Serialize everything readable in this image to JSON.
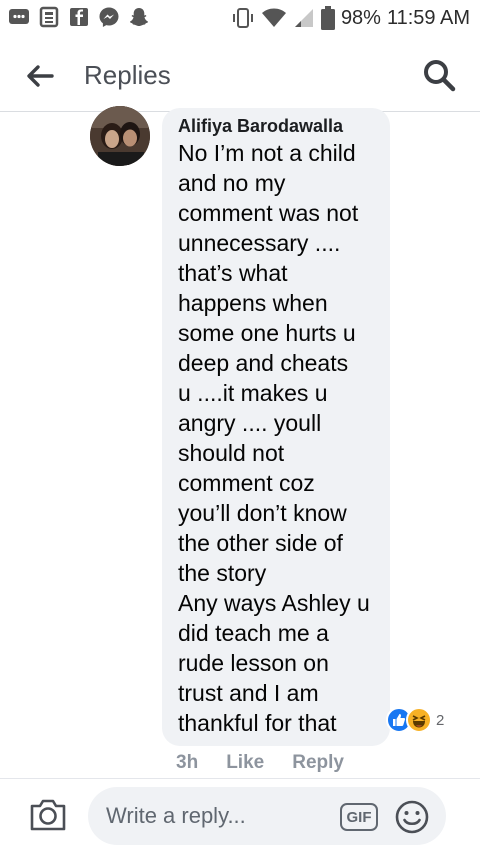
{
  "status_bar": {
    "battery": "98%",
    "time": "11:59 AM",
    "left_icons": [
      "messages-icon",
      "news-icon",
      "facebook-icon",
      "messenger-icon",
      "snapchat-icon"
    ],
    "right_icons": [
      "vibrate-icon",
      "wifi-icon",
      "signal-icon",
      "battery-icon"
    ]
  },
  "header": {
    "title": "Replies",
    "back_icon": "arrow-left-icon",
    "search_icon": "search-icon"
  },
  "comment": {
    "author": "Alifiya Barodawalla",
    "lines": [
      "No I’m not a child",
      "and no my",
      "comment was not",
      "unnecessary ....",
      "that’s what",
      "happens when",
      "some one hurts u",
      "deep and cheats",
      "u ....it makes u",
      "angry .... youll",
      "should not",
      "comment coz",
      "you’ll don’t know",
      "the other side of",
      "the story",
      "Any ways Ashley u",
      "did teach me a",
      "rude lesson on",
      "trust and I am",
      "thankful for that"
    ],
    "reaction_count": "2",
    "time_ago": "3h",
    "like_label": "Like",
    "reply_label": "Reply"
  },
  "composer": {
    "placeholder": "Write a reply...",
    "gif_label": "GIF",
    "camera_icon": "camera-icon",
    "emoji_icon": "emoji-icon"
  },
  "colors": {
    "bubble": "#f0f2f5",
    "like_blue": "#1877f2",
    "haha_yellow": "#f7b125",
    "muted": "#8d949e"
  }
}
